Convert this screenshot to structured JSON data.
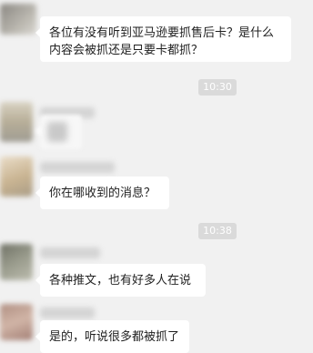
{
  "messages": [
    {
      "text": "各位有没有听到亚马逊要抓售后卡？是什么内容会被抓还是只要卡都抓？"
    },
    {
      "text": ""
    },
    {
      "text": "你在哪收到的消息？"
    },
    {
      "text": "各种推文，也有好多人在说"
    },
    {
      "text": "是的，听说很多都被抓了"
    }
  ],
  "timestamps": [
    "10:30",
    "10:38"
  ],
  "colors": {
    "background": "#f1f1f1",
    "bubble": "#ffffff",
    "timestamp_bg": "#dadada"
  }
}
